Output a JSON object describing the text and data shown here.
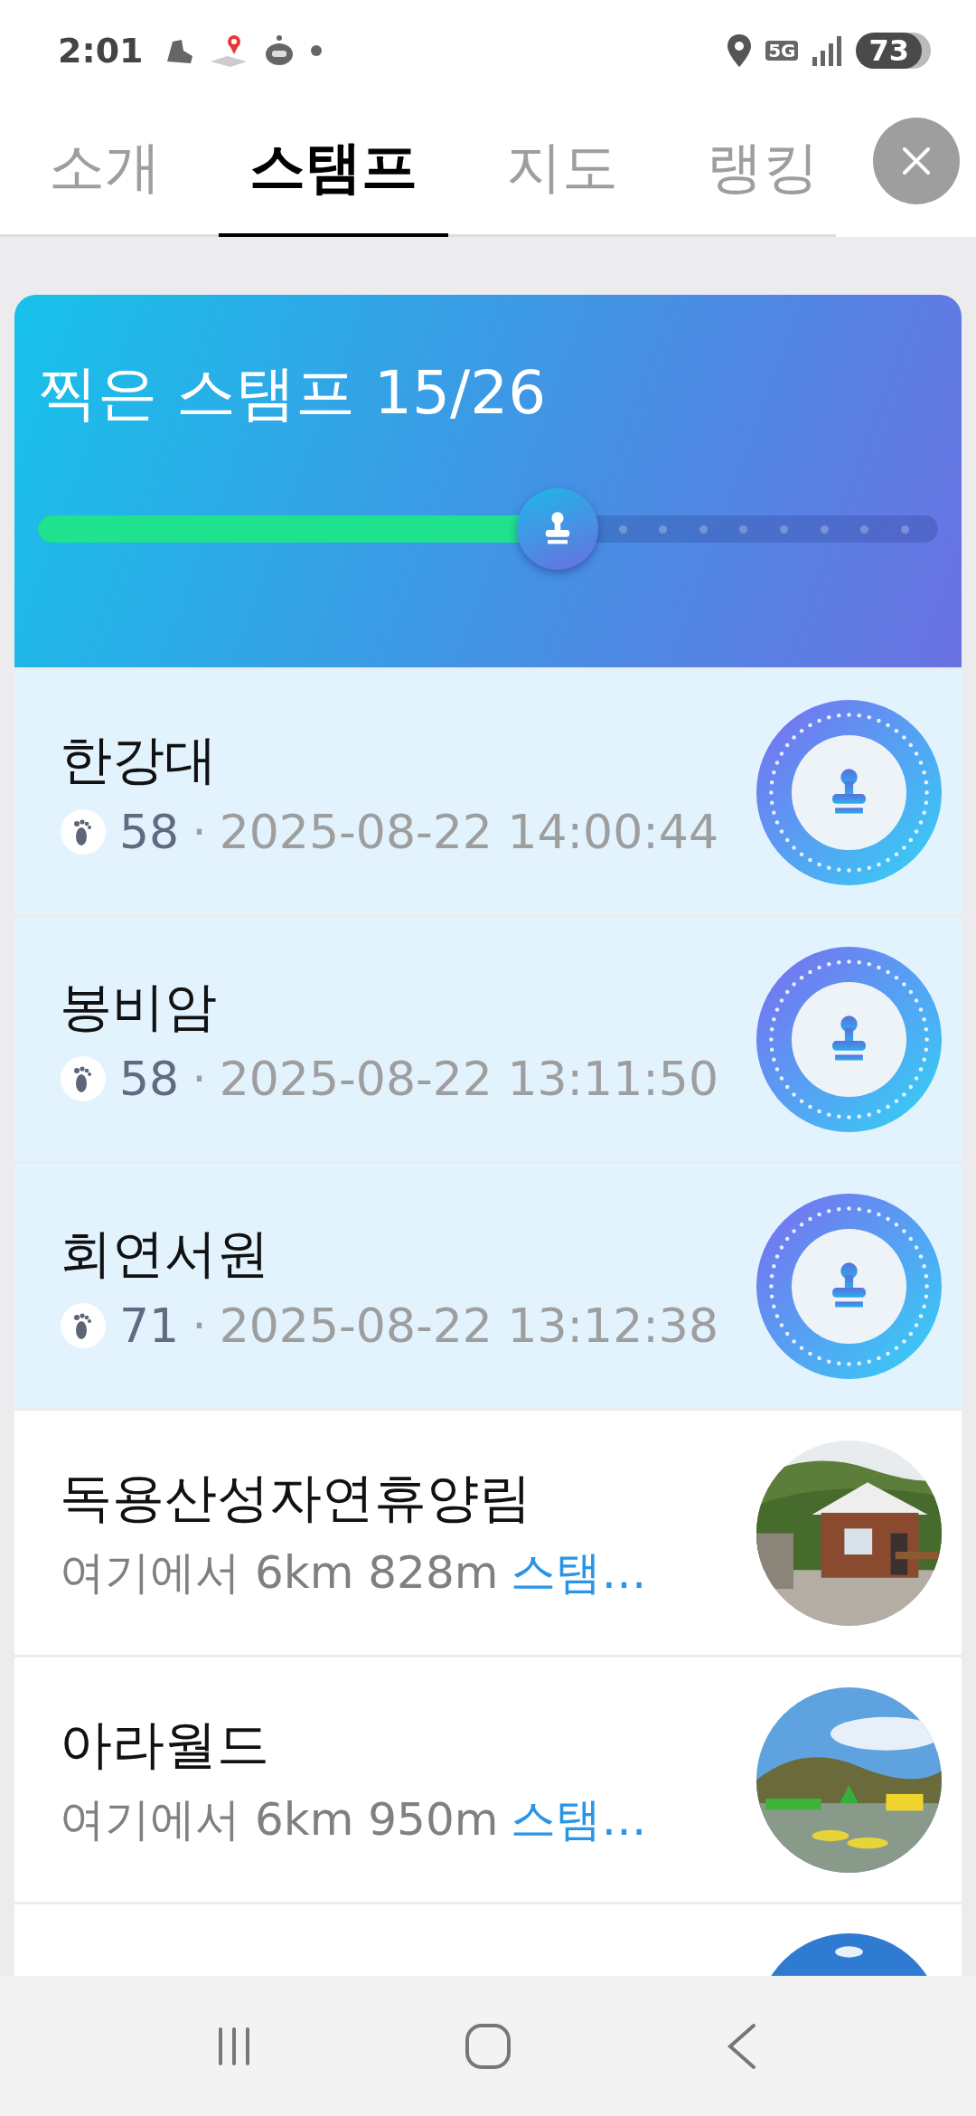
{
  "status_bar": {
    "time": "2:01",
    "network": "5G",
    "battery": "73"
  },
  "tabs": [
    {
      "label": "소개",
      "selected": false
    },
    {
      "label": "스탬프",
      "selected": true
    },
    {
      "label": "지도",
      "selected": false
    },
    {
      "label": "랭킹",
      "selected": false
    }
  ],
  "progress": {
    "title": "찍은 스탬프 15/26",
    "level": 0.577
  },
  "places": [
    {
      "kind": "stamped",
      "name": "한강대",
      "steps": "58",
      "separator": "·",
      "time": "2025-08-22 14:00:44"
    },
    {
      "kind": "stamped",
      "name": "봉비암",
      "steps": "58",
      "separator": "·",
      "time": "2025-08-22 13:11:50"
    },
    {
      "kind": "stamped",
      "name": "회연서원",
      "steps": "71",
      "separator": "·",
      "time": "2025-08-22 13:12:38"
    },
    {
      "kind": "nearby",
      "name": "독용산성자연휴양림",
      "distance": "여기에서 6km 828m",
      "action": "스탬…"
    },
    {
      "kind": "nearby",
      "name": "아라월드",
      "distance": "여기에서 6km 950m",
      "action": "스탬…"
    },
    {
      "kind": "partial"
    }
  ]
}
